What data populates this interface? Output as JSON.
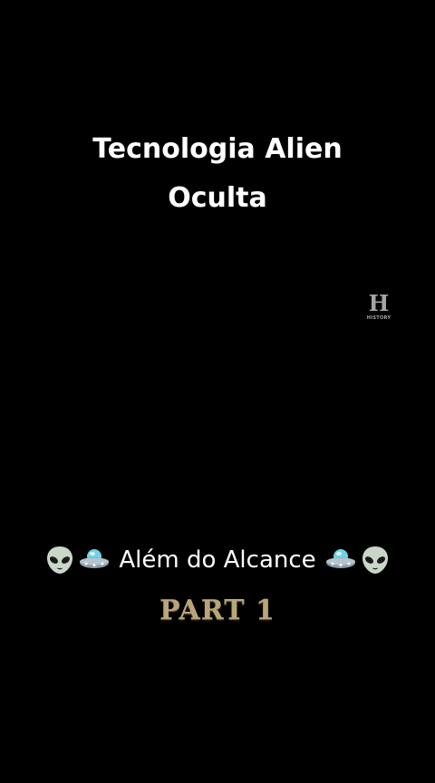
{
  "video": {
    "title_line1": "Tecnologia Alien",
    "title_line2": "Oculta",
    "caption": "Além do Alcance",
    "part_label": "PART 1"
  },
  "watermark": {
    "logo_letter": "H",
    "logo_word": "HISTORY"
  },
  "icons": {
    "left": [
      "alien-icon",
      "ufo-icon"
    ],
    "right": [
      "ufo-icon",
      "alien-icon"
    ]
  },
  "colors": {
    "background": "#000000",
    "title_text": "#ffffff",
    "part_label": "#b9a57a",
    "alien": "#c9d6c8",
    "ufo_dome": "#6fd3e6",
    "ufo_body": "#8a9ba8"
  }
}
